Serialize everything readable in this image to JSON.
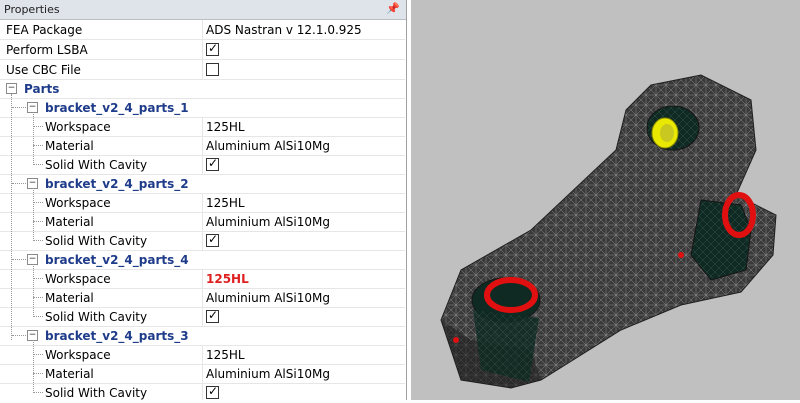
{
  "panel": {
    "title": "Properties",
    "pin_icon": "pin-icon"
  },
  "properties": {
    "fea_package": {
      "label": "FEA Package",
      "value": "ADS Nastran v 12.1.0.925"
    },
    "perform_lsba": {
      "label": "Perform LSBA",
      "checked": true
    },
    "use_cbc_file": {
      "label": "Use CBC File",
      "checked": false
    }
  },
  "parts": {
    "label": "Parts",
    "items": [
      {
        "name": "bracket_v2_4_parts_1",
        "workspace_label": "Workspace",
        "workspace": "125HL",
        "material_label": "Material",
        "material": "Aluminium AlSi10Mg",
        "solid_label": "Solid With Cavity",
        "solid_checked": true,
        "highlight": false
      },
      {
        "name": "bracket_v2_4_parts_2",
        "workspace_label": "Workspace",
        "workspace": "125HL",
        "material_label": "Material",
        "material": "Aluminium AlSi10Mg",
        "solid_label": "Solid With Cavity",
        "solid_checked": true,
        "highlight": false
      },
      {
        "name": "bracket_v2_4_parts_4",
        "workspace_label": "Workspace",
        "workspace": "125HL",
        "material_label": "Material",
        "material": "Aluminium AlSi10Mg",
        "solid_label": "Solid With Cavity",
        "solid_checked": true,
        "highlight": true
      },
      {
        "name": "bracket_v2_4_parts_3",
        "workspace_label": "Workspace",
        "workspace": "125HL",
        "material_label": "Material",
        "material": "Aluminium AlSi10Mg",
        "solid_label": "Solid With Cavity",
        "solid_checked": true,
        "highlight": false
      }
    ]
  },
  "colors": {
    "highlight": "#e02020",
    "group_text": "#1f3c8a",
    "viewport_bg": "#c0c0c0",
    "mesh": "#3c3c3c",
    "hole_red": "#e01010",
    "hole_yellow": "#e8e800"
  },
  "viewport": {
    "content": "3d-mesh-bracket"
  }
}
